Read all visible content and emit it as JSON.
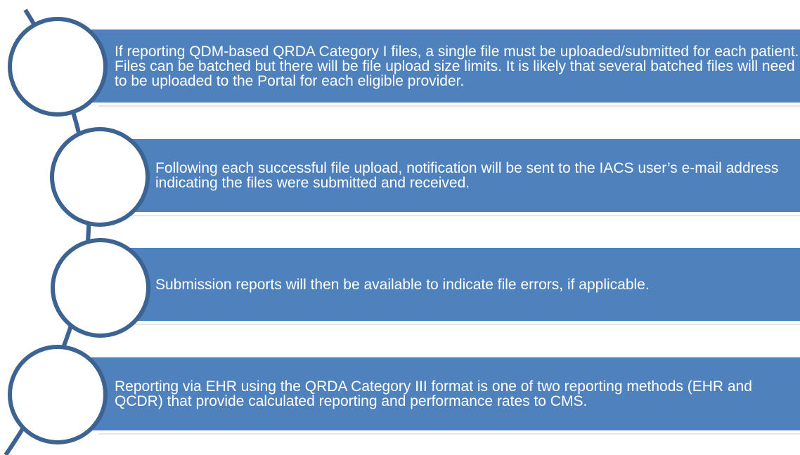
{
  "colors": {
    "bar": "#4f81bd",
    "bar_text": "#ffffff",
    "arc": "#3c6391",
    "circle_fill": "#ffffff",
    "separator": "#e6e6e6"
  },
  "items": [
    {
      "text": "If reporting QDM-based QRDA Category I files, a single file must be uploaded/submitted for each patient. Files can be batched but there will be file upload size limits. It is likely that several batched files will need to be uploaded to the Portal for each eligible provider."
    },
    {
      "text": "Following each successful file upload, notification will be sent to the IACS user’s e-mail address indicating the files were submitted and received."
    },
    {
      "text": "Submission reports will then be available to indicate file errors, if applicable."
    },
    {
      "text": "Reporting via EHR using the QRDA Category III format is one of two reporting methods (EHR and QCDR) that provide calculated reporting and performance rates to CMS."
    }
  ]
}
